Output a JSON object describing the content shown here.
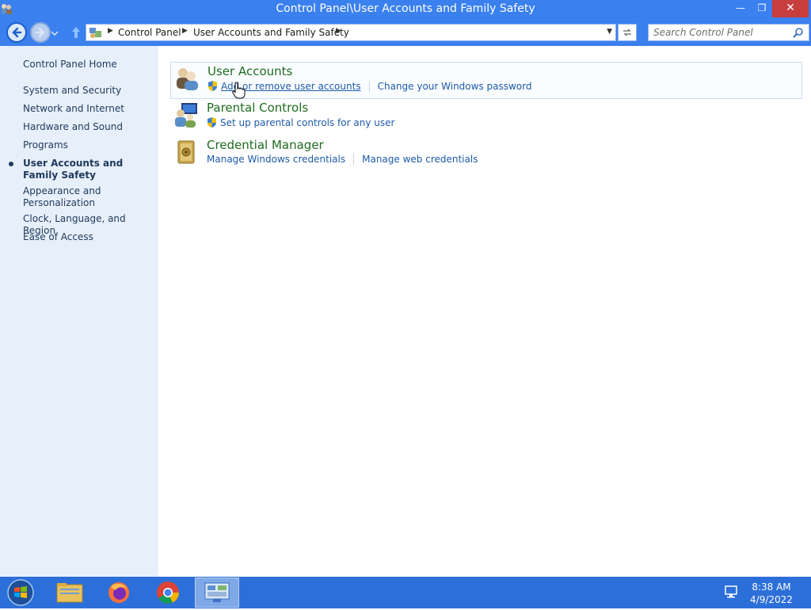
{
  "window": {
    "title": "Control Panel\\User Accounts and Family Safety",
    "controls": {
      "minimize": "—",
      "maximize": "❐",
      "close": "✕"
    }
  },
  "navigation": {
    "breadcrumb": [
      "Control Panel",
      "User Accounts and Family Safety"
    ],
    "search_placeholder": "Search Control Panel"
  },
  "sidebar": {
    "home": "Control Panel Home",
    "items": [
      {
        "label": "System and Security",
        "active": false
      },
      {
        "label": "Network and Internet",
        "active": false
      },
      {
        "label": "Hardware and Sound",
        "active": false
      },
      {
        "label": "Programs",
        "active": false
      },
      {
        "label": "User Accounts and Family Safety",
        "active": true
      },
      {
        "label": "Appearance and Personalization",
        "active": false
      },
      {
        "label": "Clock, Language, and Region",
        "active": false
      },
      {
        "label": "Ease of Access",
        "active": false
      }
    ]
  },
  "categories": [
    {
      "title": "User Accounts",
      "icon": "users-icon",
      "links": [
        {
          "label": "Add or remove user accounts",
          "shield": true
        },
        {
          "label": "Change your Windows password",
          "shield": false
        }
      ]
    },
    {
      "title": "Parental Controls",
      "icon": "parental-controls-icon",
      "links": [
        {
          "label": "Set up parental controls for any user",
          "shield": true
        }
      ]
    },
    {
      "title": "Credential Manager",
      "icon": "vault-icon",
      "links": [
        {
          "label": "Manage Windows credentials",
          "shield": false
        },
        {
          "label": "Manage web credentials",
          "shield": false
        }
      ]
    }
  ],
  "taskbar": {
    "apps": [
      "windows-explorer",
      "firefox",
      "chrome",
      "control-panel"
    ],
    "active_app": "control-panel",
    "time": "8:38 AM",
    "date": "4/9/2022"
  },
  "colors": {
    "titlebar": "#3a80ee",
    "sidebar": "#e7effa",
    "category_title": "#1f6b1f",
    "link": "#1e5aa8",
    "close": "#c83d3d",
    "taskbar": "#2d6fd8"
  }
}
